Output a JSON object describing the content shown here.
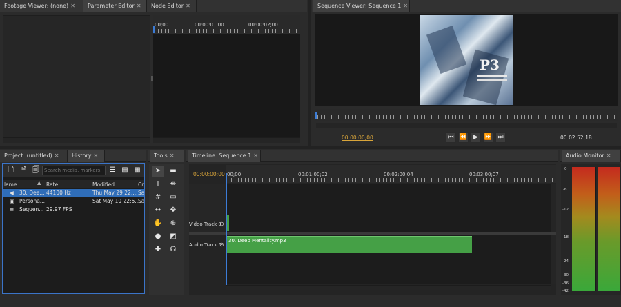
{
  "footage_panel": {
    "tabs": [
      "Footage Viewer: (none)",
      "Parameter Editor",
      "Node Editor"
    ],
    "ruler_labels": [
      "00;00",
      "00:00:01;00",
      "00:00:02;00"
    ]
  },
  "sequence_viewer": {
    "tab": "Sequence Viewer: Sequence 1",
    "current_time": "00:00:00;00",
    "duration": "00:02:52;18",
    "preview_title": "P3"
  },
  "project_panel": {
    "tabs": [
      "Project: (untitled)",
      "History"
    ],
    "search_placeholder": "Search media, markers, e...",
    "columns": [
      "lame",
      "Rate",
      "Modified",
      "Cr"
    ],
    "items": [
      {
        "name": "30. Dee...",
        "rate": "44100 Hz",
        "modified": "Thu May 29 22:...",
        "cr": "Sa",
        "icon": "audio-icon",
        "selected": true
      },
      {
        "name": "Persona...",
        "rate": "",
        "modified": "Sat May 10 22:5...",
        "cr": "Sa",
        "icon": "image-icon",
        "selected": false
      },
      {
        "name": "Sequen...",
        "rate": "29.97 FPS",
        "modified": "",
        "cr": "",
        "icon": "sequence-icon",
        "selected": false
      }
    ]
  },
  "tools_panel": {
    "tab": "Tools"
  },
  "timeline": {
    "tab": "Timeline: Sequence 1",
    "current_time": "00:00:00;00",
    "ruler_labels": [
      "00;00",
      "00:01:00;02",
      "00:02:00;04",
      "00:03:00;07"
    ],
    "video_track": "Video Track 0",
    "audio_track": "Audio Track 0",
    "audio_clip": "30. Deep Mentality.mp3"
  },
  "audio_monitor": {
    "tab": "Audio Monitor",
    "scale": [
      "0",
      "-6",
      "-12",
      "-18",
      "-24",
      "-30",
      "-36",
      "-42"
    ]
  },
  "colors": {
    "accent_time": "#d9a53a",
    "clip_green": "#45a046",
    "selection": "#2f6db8"
  }
}
